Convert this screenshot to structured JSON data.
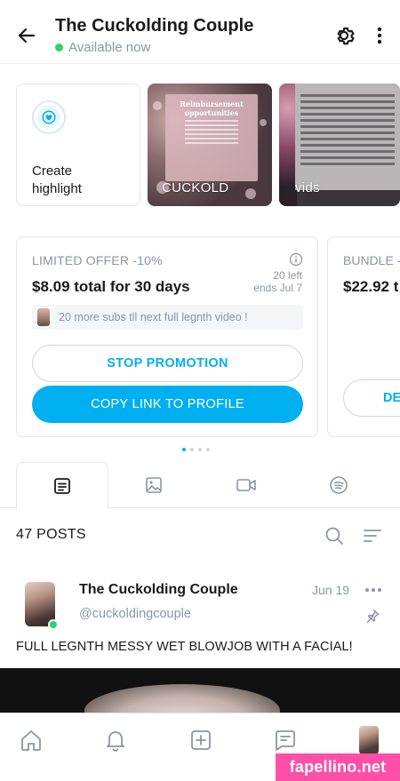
{
  "header": {
    "title": "The Cuckolding Couple",
    "status": "Available now",
    "icons": [
      "arrow-left-icon",
      "gear-icon",
      "more-vertical-icon"
    ]
  },
  "highlights": {
    "create_label": "Create\nhighlight",
    "items": [
      {
        "label": "CUCKOLD",
        "card_title": "Reimbursement\nopportunities"
      },
      {
        "label": "vids"
      }
    ]
  },
  "promotion": {
    "kicker": "LIMITED OFFER -10%",
    "price": "$8.09 total for 30 days",
    "left": "20 left",
    "ends": "ends Jul 7",
    "message": "20 more subs tll next full legnth video !",
    "stop_label": "STOP PROMOTION",
    "copy_label": "COPY LINK TO PROFILE"
  },
  "promotion_next": {
    "kicker": "BUNDLE -",
    "price": "$22.92 t",
    "button_label": "DE"
  },
  "pager": {
    "pages": 4,
    "current": 1
  },
  "tabs": [
    "posts-icon",
    "photos-icon",
    "videos-icon",
    "audio-icon"
  ],
  "posts": {
    "count_label": "47 POSTS",
    "items": [
      {
        "author": "The Cuckolding Couple",
        "handle": "@cuckoldingcouple",
        "date": "Jun 19",
        "text": "FULL LEGNTH MESSY WET BLOWJOB WITH A FACIAL!"
      }
    ]
  },
  "bottom_nav": [
    "home-icon",
    "bell-icon",
    "plus-square-icon",
    "messages-icon",
    "profile-avatar"
  ],
  "watermark": "fapellino.net",
  "colors": {
    "accent": "#00aff0",
    "online": "#2bd26d",
    "muted": "#8a96a3",
    "watermark": "#ff4fa8"
  }
}
